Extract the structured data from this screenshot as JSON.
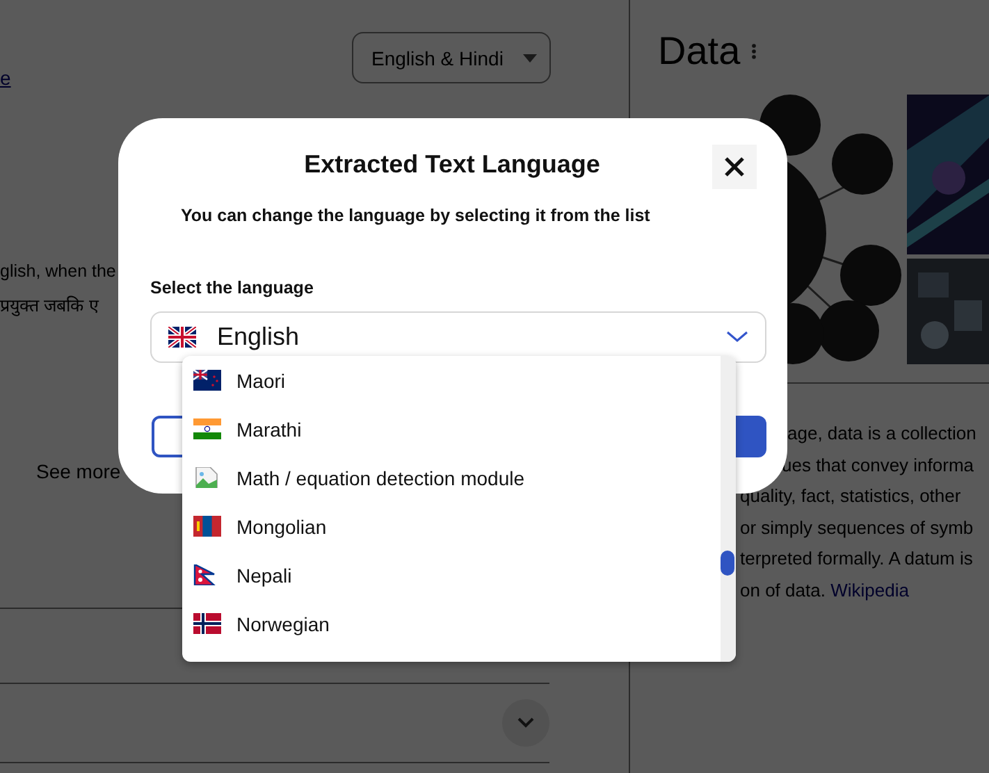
{
  "page": {
    "link_fragment": "e",
    "language_menu": "English & Hindi",
    "text_lines": [
      {
        "text": "glish, when the"
      },
      {
        "text": "प्रयुक्त जबकि ए"
      }
    ],
    "see_more": "See more"
  },
  "knowledge_panel": {
    "title": "Data",
    "description_lines": [
      "age, data is a collection",
      "ues that convey informa",
      "quality, fact, statistics, other",
      "or simply sequences of symb",
      "terpreted formally. A datum is",
      "on of data."
    ],
    "source_link": "Wikipedia"
  },
  "dialog": {
    "title": "Extracted Text Language",
    "subtitle": "You can change the language by selecting it from the list",
    "field_label": "Select the language",
    "select": {
      "kind": "gb",
      "value": "English",
      "expanded": true
    },
    "options": [
      {
        "label": "Maori",
        "kind": "nz"
      },
      {
        "label": "Marathi",
        "kind": "in"
      },
      {
        "label": "Math / equation detection module",
        "kind": "broken"
      },
      {
        "label": "Mongolian",
        "kind": "mn"
      },
      {
        "label": "Nepali",
        "kind": "np"
      },
      {
        "label": "Norwegian",
        "kind": "no"
      }
    ]
  }
}
